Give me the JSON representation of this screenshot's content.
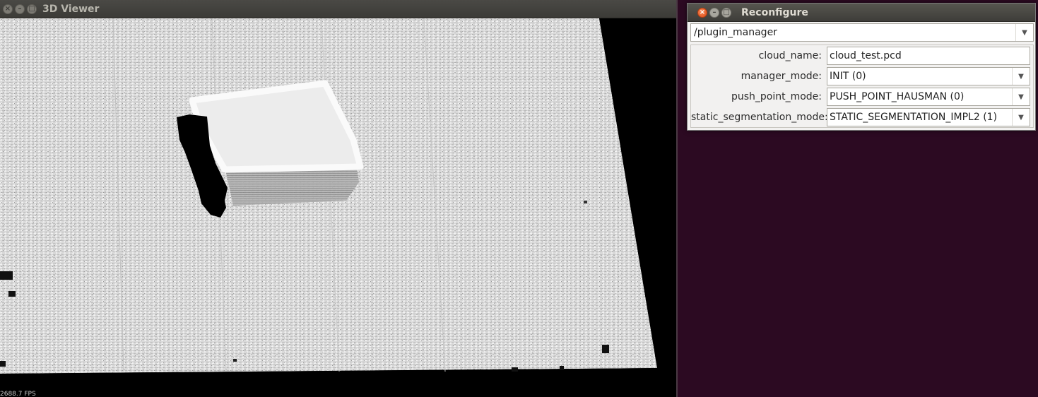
{
  "viewer": {
    "title": "3D Viewer",
    "fps": "2688.7 FPS"
  },
  "reconfigure": {
    "title": "Reconfigure",
    "node": "/plugin_manager",
    "params": [
      {
        "label": "cloud_name:",
        "value": "cloud_test.pcd",
        "kind": "text"
      },
      {
        "label": "manager_mode:",
        "value": "INIT (0)",
        "kind": "enum"
      },
      {
        "label": "push_point_mode:",
        "value": "PUSH_POINT_HAUSMAN (0)",
        "kind": "enum"
      },
      {
        "label": "static_segmentation_mode:",
        "value": "STATIC_SEGMENTATION_IMPL2 (1)",
        "kind": "enum"
      }
    ]
  },
  "window_buttons": {
    "close": "×",
    "minimize": "–",
    "maximize": "□"
  },
  "colors": {
    "desktop_bg": "#2c0a22",
    "close_button": "#df4a16",
    "titlebar": "#3c3b37",
    "pointcloud": "#dcdcdc"
  }
}
